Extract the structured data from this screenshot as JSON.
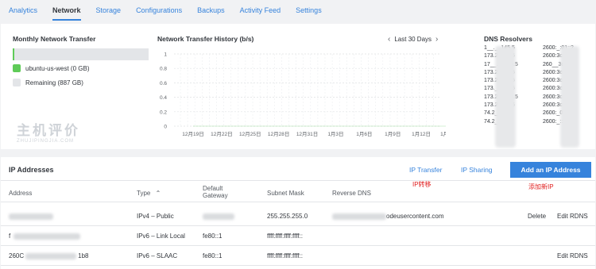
{
  "tabs": [
    {
      "label": "Analytics",
      "active": false
    },
    {
      "label": "Network",
      "active": true
    },
    {
      "label": "Storage",
      "active": false
    },
    {
      "label": "Configurations",
      "active": false
    },
    {
      "label": "Backups",
      "active": false
    },
    {
      "label": "Activity Feed",
      "active": false
    },
    {
      "label": "Settings",
      "active": false
    }
  ],
  "transfer": {
    "title": "Monthly Network Transfer",
    "used_fraction": 0.005,
    "used_label": "ubuntu-us-west (0 GB)",
    "remaining_label": "Remaining (887 GB)",
    "used_color": "#5fcb58",
    "remaining_color": "#e3e5e8"
  },
  "watermark": {
    "main": "主机评价",
    "sub": "ZHUJIPINGJIA.COM"
  },
  "history": {
    "title": "Network Transfer History (b/s)",
    "range_label": "Last 30 Days",
    "prev_icon": "chevron-left-icon",
    "next_icon": "chevron-right-icon"
  },
  "chart_data": {
    "type": "line",
    "title": "Network Transfer History (b/s)",
    "x": [
      "12月19日",
      "12月22日",
      "12月25日",
      "12月28日",
      "12月31日",
      "1月3日",
      "1月6日",
      "1月9日",
      "1月12日",
      "1月15日"
    ],
    "y_ticks": [
      "0",
      "0.2",
      "0.4",
      "0.6",
      "0.8",
      "1"
    ],
    "ylim": [
      0,
      1
    ],
    "grid": true,
    "series": [
      {
        "values": [
          0,
          0,
          0,
          0,
          0,
          0,
          0,
          0,
          0,
          0
        ]
      }
    ]
  },
  "dns": {
    "title": "DNS Resolvers",
    "col1": [
      "1__.__145.5",
      "173.2_147.5",
      "17__.__155.5",
      "173.2_212.5",
      "173.2_219.5",
      "173.__241.5",
      "173.25_243.5",
      "173.2_244.5",
      "74.2_41.5",
      "74.2_242.5"
    ],
    "col2": [
      "2600:_:01::2",
      "2600:3c01::9",
      "260__3c01::5",
      "2600:3c01::7",
      "2600:3c01::3",
      "2600:3c01::8",
      "2600:3c01::6",
      "2600:3c01::b",
      "2600:_01::c",
      "2600:_:::6"
    ]
  },
  "ip": {
    "title": "IP Addresses",
    "ip_transfer": "IP Transfer",
    "ip_sharing": "IP Sharing",
    "add_button": "Add an IP Address",
    "annot_transfer": "IP转移",
    "annot_add": "添加新IP",
    "headers": {
      "address": "Address",
      "type": "Type",
      "gateway_line1": "Default",
      "gateway_line2": "Gateway",
      "subnet": "Subnet Mask",
      "rdns": "Reverse DNS"
    },
    "sort_icon": "chevron-up-icon",
    "rows": [
      {
        "address": "",
        "type": "IPv4 – Public",
        "gateway": "",
        "subnet": "255.255.255.0",
        "rdns": "odeusercontent.com",
        "delete": "Delete",
        "edit": "Edit RDNS"
      },
      {
        "address": "f",
        "type": "IPv6 – Link Local",
        "gateway": "fe80::1",
        "subnet": "ffff:ffff:ffff:ffff::",
        "rdns": "",
        "delete": "",
        "edit": ""
      },
      {
        "address": "260C",
        "address_tail": "1b8",
        "type": "IPv6 – SLAAC",
        "gateway": "fe80::1",
        "subnet": "ffff:ffff:ffff:ffff::",
        "rdns": "",
        "delete": "",
        "edit": "Edit RDNS"
      }
    ]
  }
}
